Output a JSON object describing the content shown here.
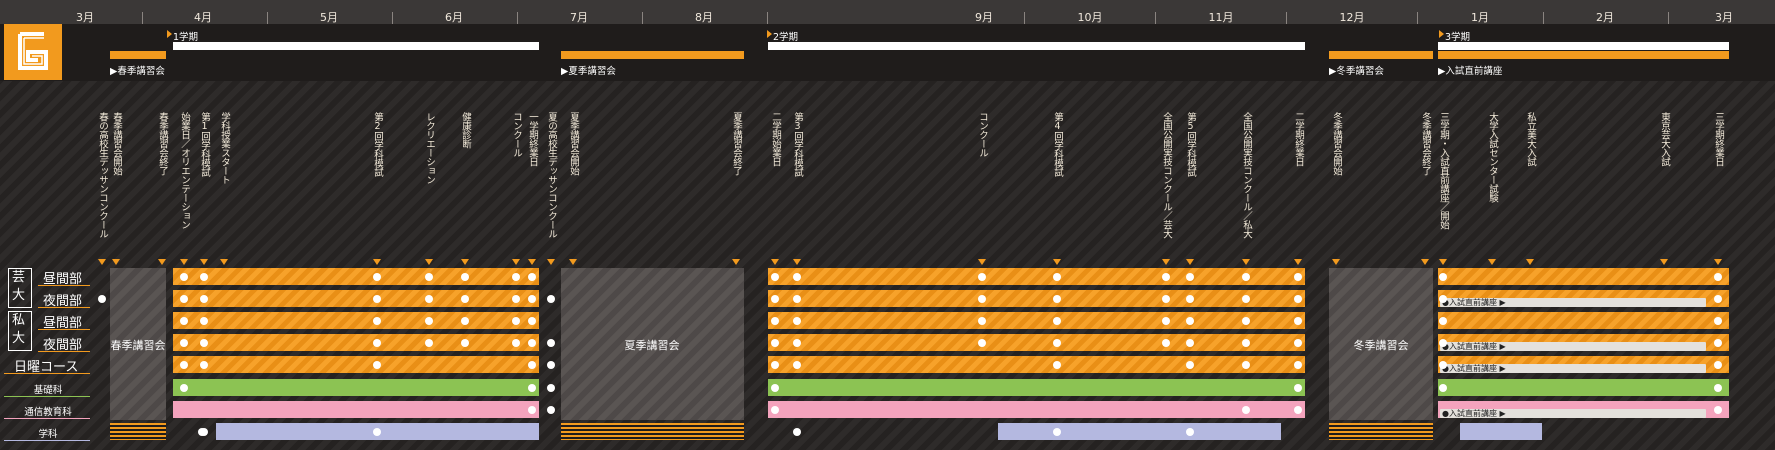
{
  "months": [
    {
      "label": "3月"
    },
    {
      "label": "4月"
    },
    {
      "label": "5月"
    },
    {
      "label": "6月"
    },
    {
      "label": "7月"
    },
    {
      "label": "8月"
    },
    {
      "label": "9月"
    },
    {
      "label": "10月"
    },
    {
      "label": "11月"
    },
    {
      "label": "12月"
    },
    {
      "label": "1月"
    },
    {
      "label": "2月"
    },
    {
      "label": "3月"
    }
  ],
  "terms": {
    "term1": "1学期",
    "term2": "2学期",
    "term3": "3学期",
    "spring": "春季講習会",
    "summer": "夏季講習会",
    "winter": "冬季講習会",
    "final": "入試直前講座"
  },
  "events": [
    "春の高校生デッサンコンクール",
    "春季講習会開始",
    "春季講習会終了",
    "始業日／オリエンテーション",
    "第1回学科模試",
    "学科授業スタート",
    "第2回学科模試",
    "レクリエーション",
    "健康診断",
    "一学期終業日",
    "コンクール",
    "夏の高校生デッサンコンクール",
    "夏季講習会開始",
    "夏季講習会終了",
    "二学期始業日",
    "第3回学科模試",
    "コンクール",
    "第4回学科模試",
    "全国公開実技コンクール／芸大",
    "第5回学科模試",
    "全国公開実技コンクール／私大",
    "二学期終業日",
    "冬季講習会開始",
    "冬季講習会終了",
    "三学期・入試直前講座／開始",
    "大学入試センター試験",
    "私立美大入試",
    "東京芸大入試",
    "三学期終業日"
  ],
  "rows": {
    "geidai_badge": "芸大",
    "shidai_badge": "私大",
    "day": "昼間部",
    "night": "夜間部",
    "sunday": "日曜コース",
    "basic": "基礎科",
    "correspondence": "通信教育科",
    "academic": "学科"
  },
  "blocks": {
    "spring": "春季講習会",
    "summer": "夏季講習会",
    "winter": "冬季講習会"
  },
  "pill_label": "●入試直前講座 ▶",
  "colors": {
    "orange": "#f29a1e",
    "green": "#8cc353",
    "pink": "#f4a3bd",
    "blue": "#b4b8e0",
    "background": "#2a2726"
  }
}
